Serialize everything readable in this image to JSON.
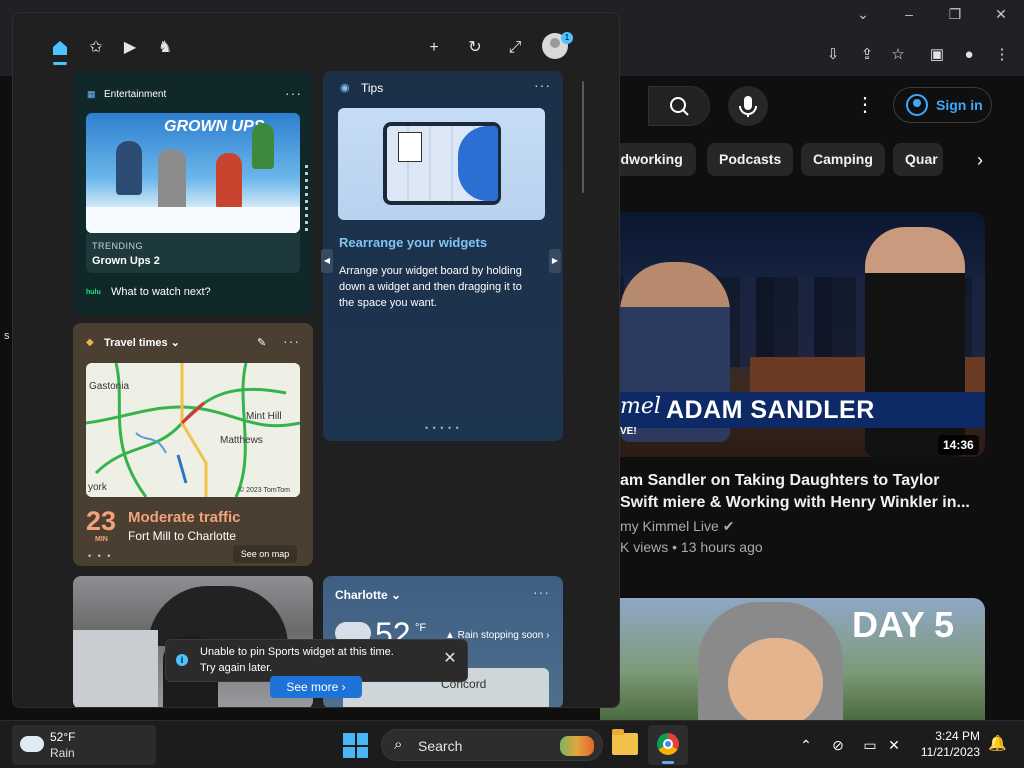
{
  "browser": {
    "window_controls": [
      "⌄",
      "–",
      "❐",
      "✕"
    ],
    "toolbar_icons": [
      "install-icon",
      "share-icon",
      "star-icon",
      "side-panel-icon",
      "profile-icon",
      "more-icon"
    ]
  },
  "youtube": {
    "signin_label": "Sign in",
    "chips": [
      "odworking",
      "Podcasts",
      "Camping",
      "Quar"
    ],
    "video1": {
      "banner_text": "ADAM SANDLER",
      "overlay_italic": "mel",
      "overlay_live": "VE!",
      "duration": "14:36",
      "title": "am Sandler on Taking Daughters to Taylor Swift miere & Working with Henry Winkler in...",
      "channel": "my Kimmel Live",
      "meta": "K views • 13 hours ago"
    },
    "video2": {
      "thumb_text": "DAY 5"
    },
    "edge_text": "s"
  },
  "widgets": {
    "nav": [
      "home-icon",
      "favorites-icon",
      "video-icon",
      "chess-icon"
    ],
    "header_actions": [
      "+",
      "↻",
      "⤢"
    ],
    "avatar_badge": "1",
    "entertainment": {
      "title": "Entertainment",
      "menu": "···",
      "logo_text": "GROWN UPS",
      "kicker": "TRENDING",
      "name": "Grown Ups 2",
      "provider": "hulu",
      "cta": "What to watch next?"
    },
    "travel": {
      "title": "Travel times",
      "menu": "···",
      "map_labels": [
        "Gastonia",
        "Mint Hill",
        "Matthews",
        "york",
        "© 2023 TomTom"
      ],
      "minutes": "23",
      "minutes_unit": "MIN",
      "status": "Moderate traffic",
      "route": "Fort Mill to Charlotte",
      "pager": "• • •",
      "see_on_map": "See on map"
    },
    "tips": {
      "title": "Tips",
      "menu": "···",
      "heading": "Rearrange your widgets",
      "body": "Arrange your widget board by holding down a widget and then dragging it to the space you want.",
      "pager": "• • • • •"
    },
    "weather": {
      "city": "Charlotte",
      "menu": "···",
      "temp": "52",
      "unit": "°F",
      "note": "▲ Rain stopping soon ›",
      "map_label": "Concord"
    },
    "toast": {
      "line1": "Unable to pin Sports widget at this time.",
      "line2": "Try again later.",
      "action": "See more ›"
    }
  },
  "taskbar": {
    "weather_temp": "52°F",
    "weather_cond": "Rain",
    "search_label": "Search",
    "time": "3:24 PM",
    "date": "11/21/2023"
  }
}
